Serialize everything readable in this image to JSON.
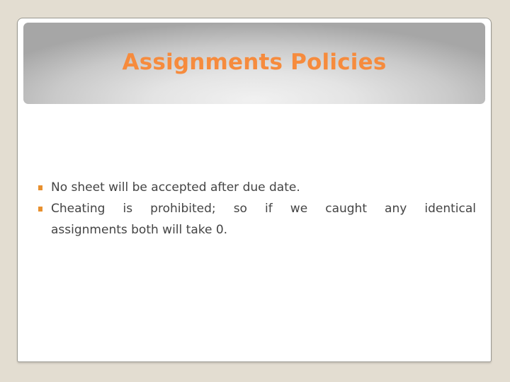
{
  "slide": {
    "title": "Assignments Policies",
    "bullets": [
      {
        "lines": [
          "No sheet will be accepted after due date."
        ]
      },
      {
        "lines": [
          "Cheating is prohibited; so if we caught any identical",
          "assignments both will take 0."
        ]
      }
    ]
  },
  "colors": {
    "title": "#f68b3d",
    "bullet": "#e8902e",
    "body_text": "#444444",
    "background": "#e3ddd1"
  }
}
